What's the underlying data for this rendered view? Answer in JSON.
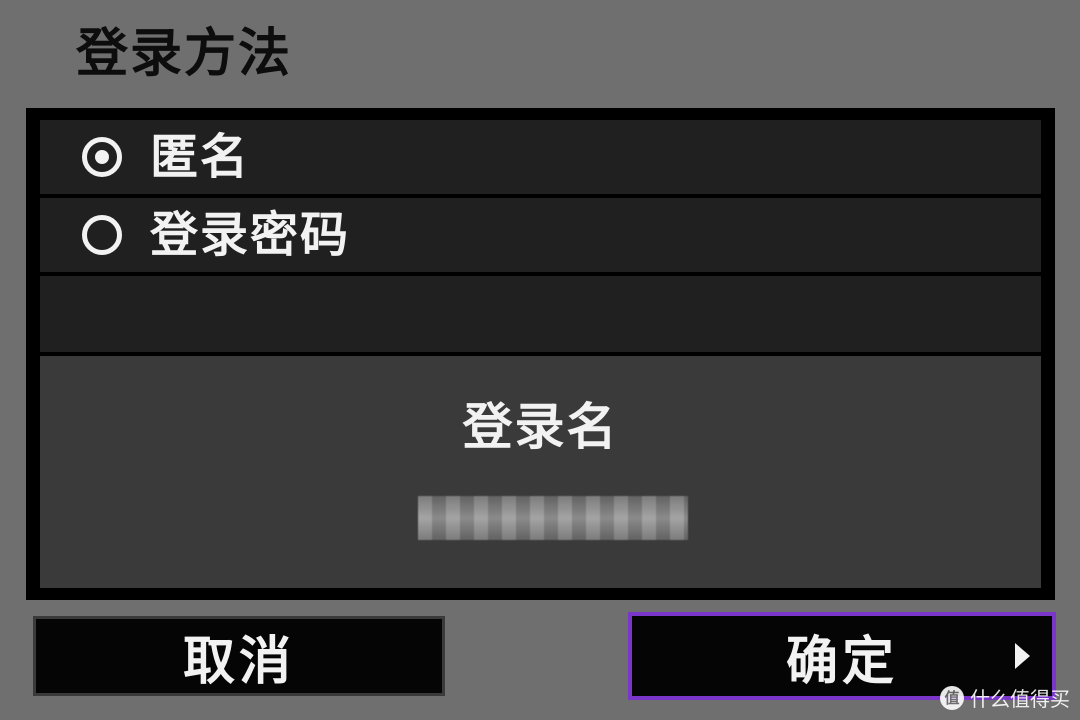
{
  "header": {
    "title": "登录方法"
  },
  "options": [
    {
      "label": "匿名",
      "selected": true
    },
    {
      "label": "登录密码",
      "selected": false
    }
  ],
  "info": {
    "label": "登录名",
    "value_hidden": true
  },
  "buttons": {
    "cancel": "取消",
    "ok": "确定"
  },
  "colors": {
    "background": "#6f6f6f",
    "panel": "#000000",
    "row": "#202020",
    "info_panel": "#3a3a3a",
    "focus": "#7a35c9"
  },
  "watermark": {
    "logo": "值",
    "text": "什么值得买"
  }
}
